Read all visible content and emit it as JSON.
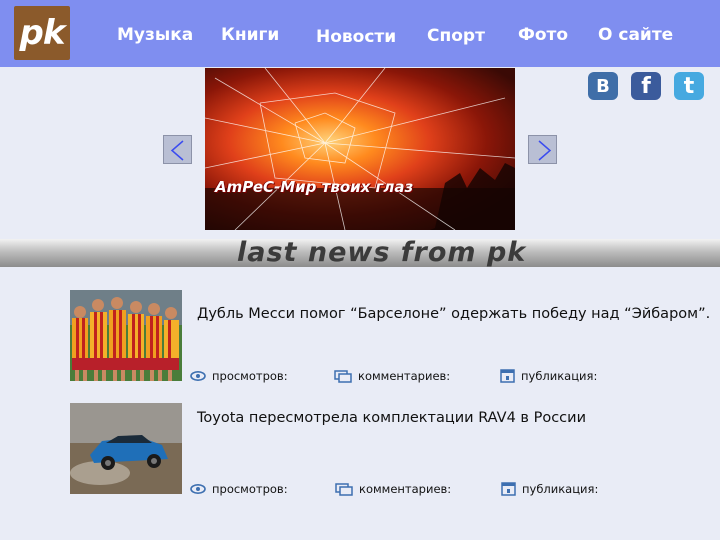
{
  "logo": {
    "text": "pk"
  },
  "nav": [
    {
      "label": "Музыка"
    },
    {
      "label": "Книги"
    },
    {
      "label": "Новости"
    },
    {
      "label": "Спорт"
    },
    {
      "label": "Фото"
    },
    {
      "label": "О сайте"
    }
  ],
  "banner": {
    "caption": "AmPeC-Мир твоих глаз"
  },
  "social": {
    "vk": "B",
    "facebook": "f",
    "twitter": "t"
  },
  "section": {
    "title": "last news from pk"
  },
  "news": [
    {
      "title": "Дубль Месси помог “Барселоне” одержать победу над “Эйбаром”.",
      "views_label": "просмотров:",
      "comments_label": "комментариев:",
      "published_label": "публикация:"
    },
    {
      "title": "Toyota пересмотрела комплектации RAV4 в России",
      "views_label": "просмотров:",
      "comments_label": "комментариев:",
      "published_label": "публикация:"
    }
  ],
  "colors": {
    "header_bg": "#7f8ef0",
    "page_bg": "#e9ecf6",
    "logo_bg": "#8b5a2b",
    "arrow_color": "#3b4cf0",
    "icon_blue": "#3d6fb0"
  }
}
